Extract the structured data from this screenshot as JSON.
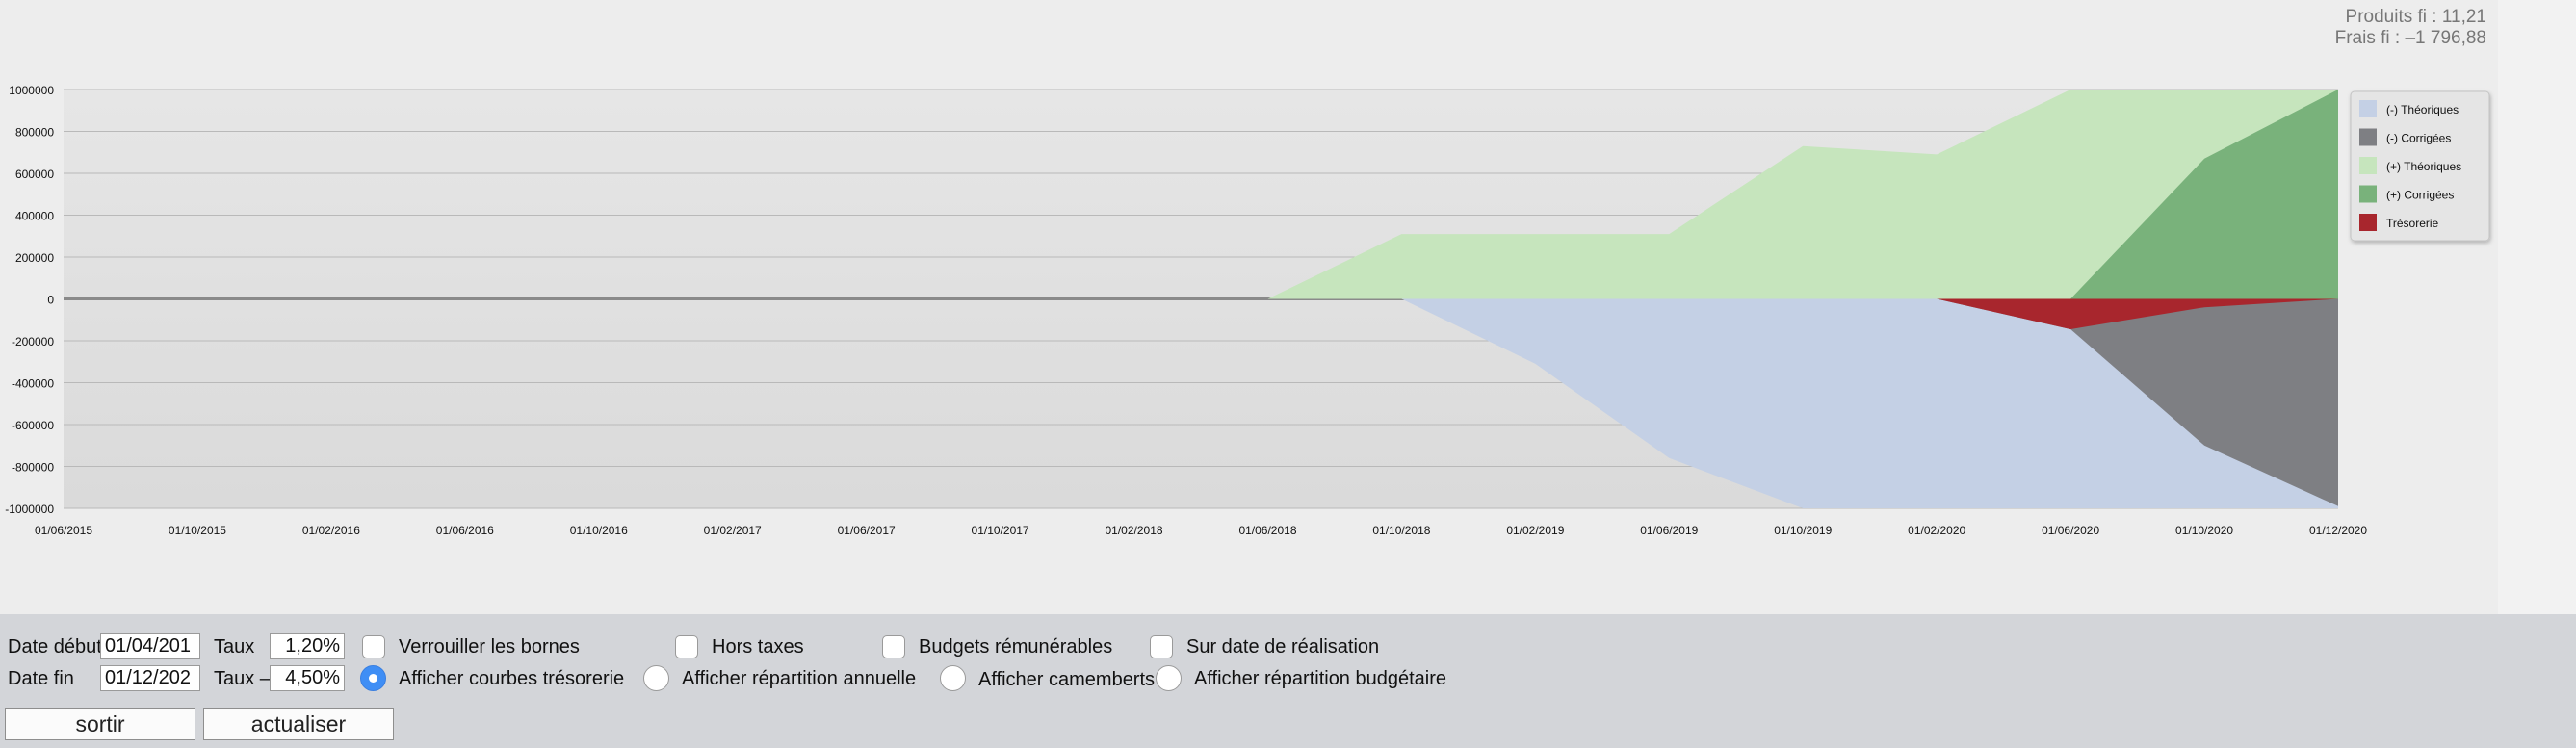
{
  "summary": {
    "produits": "Produits fi : 11,21",
    "frais": "Frais fi : –1 796,88"
  },
  "chart_data": {
    "type": "area",
    "x": [
      "01/06/2015",
      "01/10/2015",
      "01/02/2016",
      "01/06/2016",
      "01/10/2016",
      "01/02/2017",
      "01/06/2017",
      "01/10/2017",
      "01/02/2018",
      "01/06/2018",
      "01/10/2018",
      "01/02/2019",
      "01/06/2019",
      "01/10/2019",
      "01/02/2020",
      "01/06/2020",
      "01/10/2020",
      "01/12/2020"
    ],
    "y_ticks": [
      "1000000",
      "800000",
      "600000",
      "400000",
      "200000",
      "0",
      "-200000",
      "-400000",
      "-600000",
      "-800000",
      "-1000000"
    ],
    "ylim": [
      -1000000,
      1000000
    ],
    "grid": true,
    "legend_position": "right",
    "series": [
      {
        "name": "(+) Théoriques",
        "color": "#c6e5bd",
        "values": [
          0,
          0,
          0,
          0,
          0,
          0,
          0,
          0,
          0,
          0,
          310000,
          310000,
          310000,
          730000,
          690000,
          1000000,
          1000000,
          1000000
        ]
      },
      {
        "name": "(+) Corrigées",
        "color": "#79b27b",
        "values": [
          0,
          0,
          0,
          0,
          0,
          0,
          0,
          0,
          0,
          0,
          0,
          0,
          0,
          0,
          0,
          0,
          670000,
          1000000
        ]
      },
      {
        "name": "(-) Théoriques",
        "color": "#c4d0e5",
        "values": [
          0,
          0,
          0,
          0,
          0,
          0,
          0,
          0,
          0,
          0,
          0,
          -310000,
          -760000,
          -1000000,
          -1000000,
          -1000000,
          -1000000,
          -1000000
        ]
      },
      {
        "name": "(-) Corrigées",
        "color": "#7e7f83",
        "values": [
          0,
          0,
          0,
          0,
          0,
          0,
          0,
          0,
          0,
          0,
          0,
          0,
          0,
          0,
          0,
          -145000,
          -700000,
          -990000
        ]
      },
      {
        "name": "Trésorerie",
        "color": "#a8262d",
        "values": [
          0,
          0,
          0,
          0,
          0,
          0,
          0,
          0,
          0,
          0,
          0,
          0,
          0,
          0,
          0,
          -145000,
          -40000,
          0
        ]
      }
    ],
    "legend_order": [
      2,
      3,
      0,
      1,
      4
    ]
  },
  "controls": {
    "date_debut_label": "Date début",
    "date_debut_value": "01/04/201",
    "date_fin_label": "Date fin",
    "date_fin_value": "01/12/202",
    "taux_label": "Taux",
    "taux_value": "1,20%",
    "taux_minus_label": "Taux –",
    "taux_minus_value": "4,50%",
    "checkboxes": [
      {
        "label": "Verrouiller les bornes",
        "checked": false
      },
      {
        "label": "Hors taxes",
        "checked": false
      },
      {
        "label": "Budgets rémunérables",
        "checked": false
      },
      {
        "label": "Sur date de réalisation",
        "checked": false
      }
    ],
    "radios": [
      {
        "label": "Afficher courbes trésorerie",
        "checked": true
      },
      {
        "label": "Afficher répartition annuelle",
        "checked": false
      },
      {
        "label": "Afficher camemberts",
        "checked": false
      },
      {
        "label": "Afficher répartition budgétaire",
        "checked": false
      }
    ],
    "sortir_label": "sortir",
    "actualiser_label": "actualiser"
  }
}
